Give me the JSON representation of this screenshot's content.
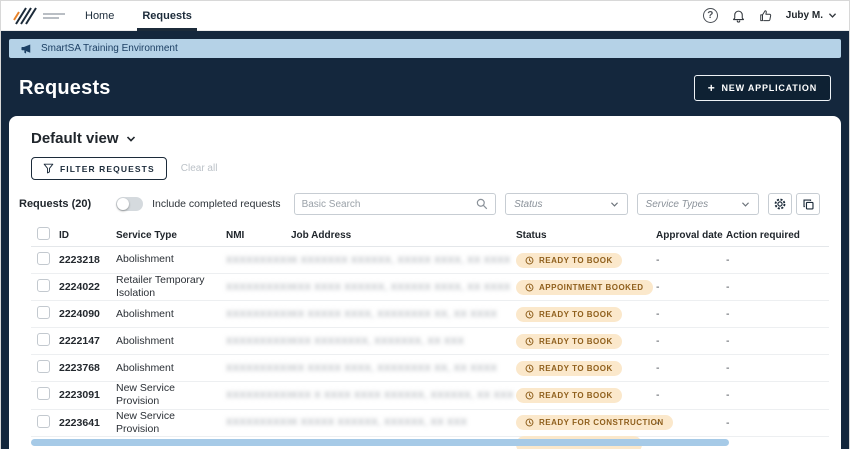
{
  "colors": {
    "navy": "#14273d",
    "banner_bg": "#b5d2e7",
    "banner_text": "#1c3f63",
    "accent": "#1c2b3a",
    "pill_bg": "#fbe8cb",
    "pill_text": "#8f5f1c",
    "scrollbar": "#a6cae7"
  },
  "topnav": {
    "nav_items": [
      {
        "label": "Home"
      },
      {
        "label": "Requests"
      }
    ],
    "help_glyph": "?",
    "user_name": "Juby M."
  },
  "banner": {
    "text": "SmartSA Training Environment"
  },
  "page_header": {
    "title": "Requests",
    "plus_glyph": "+",
    "new_application_label": "NEW APPLICATION"
  },
  "toolbar": {
    "view_label": "Default view",
    "filter_button": "FILTER REQUESTS",
    "clear_all": "Clear all",
    "count_label": "Requests (20)",
    "toggle_label": "Include completed requests",
    "search_placeholder": "Basic Search",
    "status_placeholder": "Status",
    "service_types_placeholder": "Service Types"
  },
  "table": {
    "headers": [
      "ID",
      "Service Type",
      "NMI",
      "Job Address",
      "Status",
      "Approval date",
      "Action required"
    ],
    "rows": [
      {
        "id": "2223218",
        "service_type": "Abolishment",
        "nmi": "XXXXXXXXXX",
        "address": "X XXXXXXX XXXXXX, XXXXX XXXX, XX XXXX",
        "status": "READY TO BOOK",
        "approval_date": "-",
        "action_required": "-"
      },
      {
        "id": "2224022",
        "service_type": "Retailer Temporary Isolation",
        "nmi": "XXXXXXXXXX",
        "address": "XXX XXXX XXXXXX, XXXXXX XXXX, XX XXXX",
        "status": "APPOINTMENT BOOKED",
        "approval_date": "-",
        "action_required": "-"
      },
      {
        "id": "2224090",
        "service_type": "Abolishment",
        "nmi": "XXXXXXXXXX",
        "address": "XX XXXXX XXXX, XXXXXXXX XX, XX XXXX",
        "status": "READY TO BOOK",
        "approval_date": "-",
        "action_required": "-"
      },
      {
        "id": "2222147",
        "service_type": "Abolishment",
        "nmi": "XXXXXXXXXX",
        "address": "XXX XXXXXXXX, XXXXXXX, XX XXX",
        "status": "READY TO BOOK",
        "approval_date": "-",
        "action_required": "-"
      },
      {
        "id": "2223768",
        "service_type": "Abolishment",
        "nmi": "XXXXXXXXXX",
        "address": "XX XXXXX XXXX, XXXXXXXX XX, XX XXXX",
        "status": "READY TO BOOK",
        "approval_date": "-",
        "action_required": "-"
      },
      {
        "id": "2223091",
        "service_type": "New Service Provision",
        "nmi": "XXXXXXXXXX",
        "address": "XXX X XXXX XXXX XXXXXX, XXXXXX, XX XXX",
        "status": "READY TO BOOK",
        "approval_date": "-",
        "action_required": "-"
      },
      {
        "id": "2223641",
        "service_type": "New Service Provision",
        "nmi": "XXXXXXXXXX",
        "address": "X XXXXX XXXXXX, XXXXXX, XX XXX",
        "status": "READY FOR CONSTRUCTION",
        "approval_date": "-",
        "action_required": "-"
      }
    ]
  }
}
